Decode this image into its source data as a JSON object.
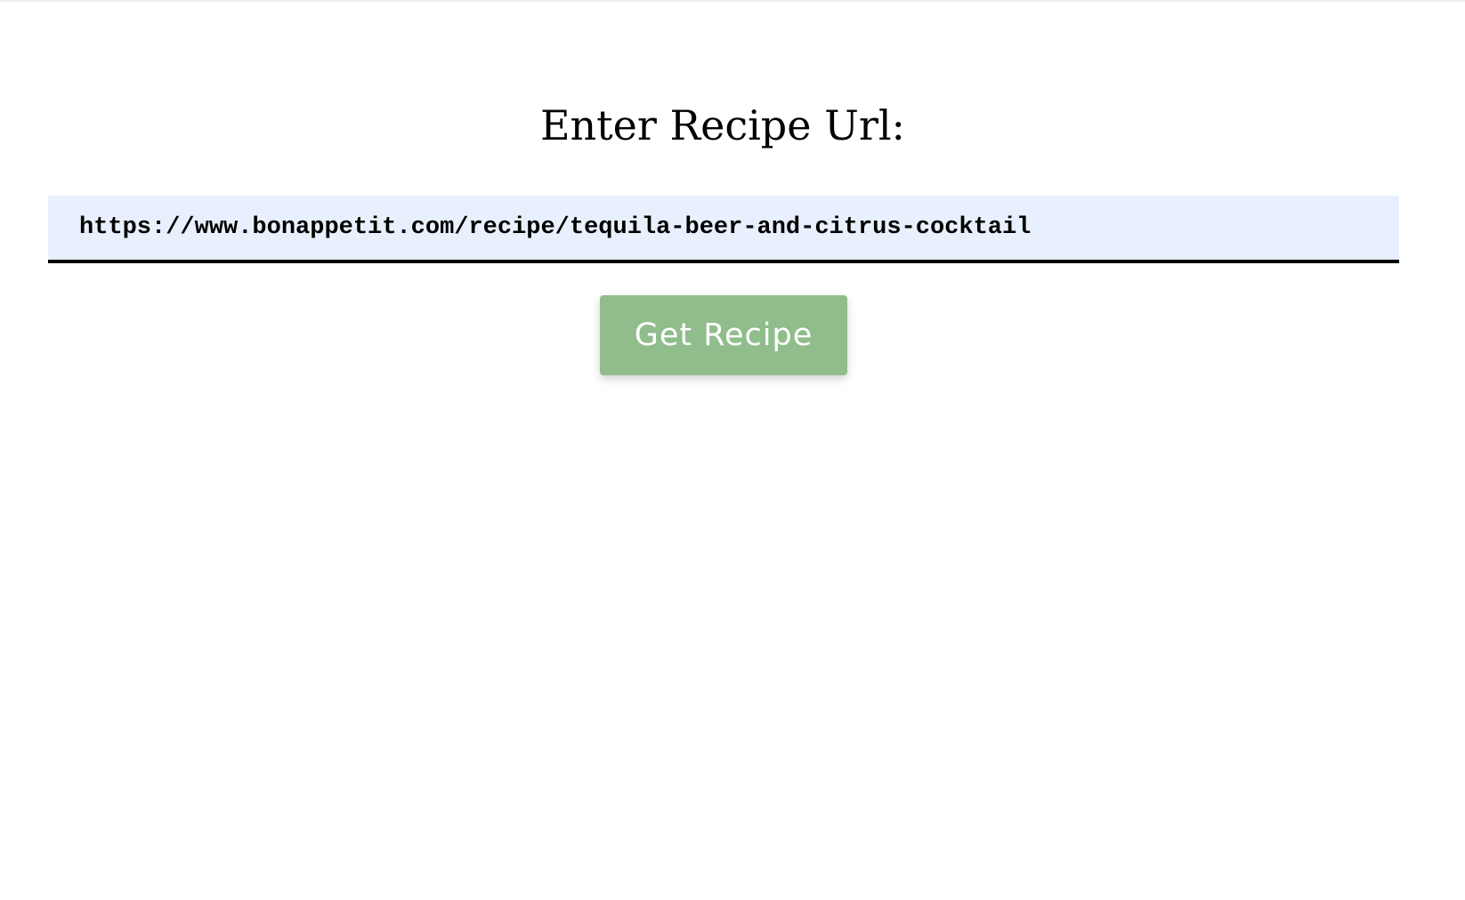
{
  "page": {
    "title": "Enter Recipe Url:"
  },
  "form": {
    "url_value": "https://www.bonappetit.com/recipe/tequila-beer-and-citrus-cocktail",
    "submit_label": "Get Recipe"
  },
  "colors": {
    "input_background": "#e8f0fd",
    "button_background": "#90bd8b",
    "button_text": "#ffffff",
    "text": "#000000"
  }
}
